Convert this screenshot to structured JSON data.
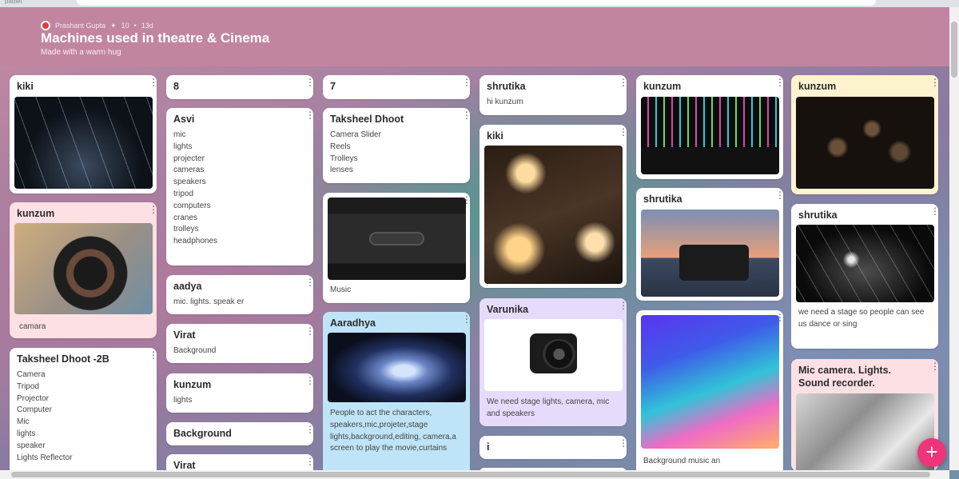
{
  "browser": {
    "tab_text": "padlet"
  },
  "header": {
    "author": "Prashant Gupta",
    "likes": "10",
    "age": "13d",
    "title": "Machines used in theatre & Cinema",
    "subtitle": "Made with a warm hug"
  },
  "columns": [
    {
      "posts": [
        {
          "title": "kiki",
          "body": "",
          "image": "stage-lights"
        },
        {
          "title": "kunzum",
          "body": "camara",
          "image": "camera-hands"
        },
        {
          "title": "Taksheel Dhoot -2B",
          "body": "Camera\nTripod\nProjector\nComputer\nMic\nlights\nspeaker\nLights Reflector"
        }
      ]
    },
    {
      "posts": [
        {
          "title": "8",
          "body": ""
        },
        {
          "title": "Asvi",
          "body": "mic\nlights\nprojecter\ncameras\nspeakers\ntripod\ncomputers\ncranes\ntrolleys\nheadphones"
        },
        {
          "title": "aadya",
          "body": "mic. lights. speak er"
        },
        {
          "title": "Virat",
          "body": "Background"
        },
        {
          "title": "kunzum",
          "body": "lights"
        },
        {
          "title": "Background",
          "body": ""
        },
        {
          "title": "Virat",
          "body": ""
        }
      ]
    },
    {
      "posts": [
        {
          "title": "7",
          "body": ""
        },
        {
          "title": "Taksheel Dhoot",
          "body": "Camera Slider\nReels\nTrolleys\nlenses"
        },
        {
          "title": "",
          "body": "Music",
          "image": "cassette"
        },
        {
          "title": "Aaradhya",
          "body": "People to act the characters, speakers,mic,projeter,stage lights,background,editing, camera,a screen to play the movie,curtains",
          "image": "concert"
        }
      ]
    },
    {
      "posts": [
        {
          "title": "shrutika",
          "body": "hi kunzum"
        },
        {
          "title": "kiki",
          "body": "",
          "image": "bulbs"
        },
        {
          "title": "Varunika",
          "body": "We need stage lights, camera, mic and speakers",
          "image": "sony-camera"
        },
        {
          "title": "i",
          "body": ""
        }
      ]
    },
    {
      "posts": [
        {
          "title": "kunzum",
          "body": "",
          "image": "neon-tubes"
        },
        {
          "title": "shrutika",
          "body": "",
          "image": "eiffel-camera"
        },
        {
          "title": "",
          "body": "Background music an",
          "image": "color-waves"
        }
      ]
    },
    {
      "posts": [
        {
          "title": "kunzum",
          "body": "",
          "image": "dark-spheres"
        },
        {
          "title": "shrutika",
          "body": "we need a stage so people can see us dance or sing",
          "image": "dark-stage"
        },
        {
          "title": "Mic camera. Lights. Sound recorder.",
          "body": "",
          "image": "film-reels"
        }
      ]
    }
  ],
  "fab": {
    "label": "+"
  },
  "colors": {
    "header": "#c285a0",
    "fab": "#f0347a",
    "pink_card": "#fce0e4",
    "lavender_card": "#e7dbfb",
    "sky_card": "#bfe4f7",
    "cream_card": "#fff3cf"
  }
}
